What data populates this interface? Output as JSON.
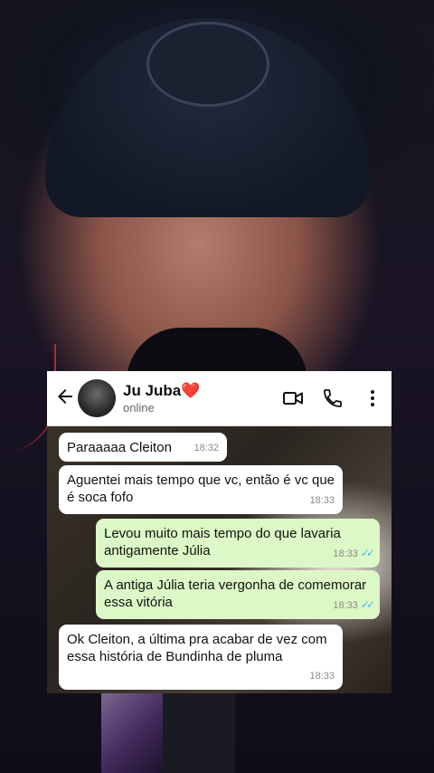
{
  "contact": {
    "name": "Ju Juba",
    "heart": "❤️",
    "status": "online"
  },
  "header_icons": [
    "back-arrow-icon",
    "video-call-icon",
    "voice-call-icon",
    "more-options-icon"
  ],
  "messages": [
    {
      "direction": "in",
      "text": "Paraaaaa Cleiton",
      "time": "18:32"
    },
    {
      "direction": "in",
      "text": "Aguentei mais tempo que vc, então é vc que é soca fofo",
      "time": "18:33"
    },
    {
      "direction": "out",
      "text": "Levou muito mais tempo do que lavaria antigamente Júlia",
      "time": "18:33",
      "read": "✓✓"
    },
    {
      "direction": "out",
      "text": "A antiga Júlia teria vergonha de comemorar essa vitória",
      "time": "18:33",
      "read": "✓✓"
    },
    {
      "direction": "in",
      "text": "Ok Cleiton, a última pra acabar de vez com essa história de Bundinha de pluma",
      "time": "18:33"
    }
  ],
  "colors": {
    "incoming_bubble": "#ffffff",
    "outgoing_bubble": "#dcf8c6",
    "read_ticks": "#4fb6ec",
    "heart": "#d6293e"
  }
}
